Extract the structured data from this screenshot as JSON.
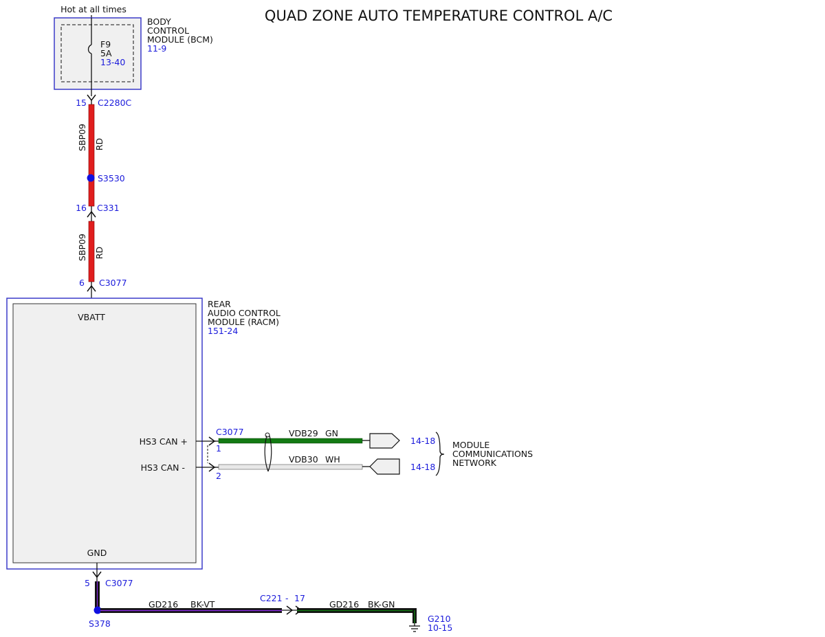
{
  "title": "QUAD ZONE AUTO TEMPERATURE CONTROL A/C",
  "colors": {
    "link": "#1a1adb",
    "wire_red": "#e01e1e",
    "wire_green": "#137a13",
    "wire_white": "#e8e8e8",
    "wire_black": "#111111",
    "wire_violet": "#8a2be2",
    "wire_dark_green": "#0f4d0f",
    "module_fill": "#f0f0f0",
    "module_border": "#3a3ac8"
  },
  "power": {
    "hot_label": "Hot at all times"
  },
  "bcm": {
    "name_lines": [
      "BODY",
      "CONTROL",
      "MODULE (BCM)"
    ],
    "ref": "11-9",
    "fuse": {
      "id": "F9",
      "rating": "5A",
      "ref": "13-40"
    }
  },
  "connectors": {
    "c2280c": {
      "pin": "15",
      "name": "C2280C"
    },
    "s3530": {
      "name": "S3530"
    },
    "c331": {
      "pin": "16",
      "name": "C331"
    },
    "c3077_top": {
      "pin": "6",
      "name": "C3077"
    },
    "c3077_can": {
      "name": "C3077",
      "pin_plus": "1",
      "pin_minus": "2"
    },
    "c3077_gnd": {
      "pin": "5",
      "name": "C3077"
    },
    "s378": {
      "name": "S378"
    },
    "c221": {
      "name": "C221",
      "sep": "-",
      "pin": "17"
    },
    "g210": {
      "name": "G210",
      "ref": "10-15"
    }
  },
  "wires": {
    "sbp09_a": {
      "circuit": "SBP09",
      "color": "RD"
    },
    "sbp09_b": {
      "circuit": "SBP09",
      "color": "RD"
    },
    "vdb29": {
      "circuit": "VDB29",
      "color": "GN",
      "ref": "14-18"
    },
    "vdb30": {
      "circuit": "VDB30",
      "color": "WH",
      "ref": "14-18"
    },
    "gd216_a": {
      "circuit": "GD216",
      "color": "BK-VT"
    },
    "gd216_b": {
      "circuit": "GD216",
      "color": "BK-GN"
    }
  },
  "racm": {
    "name_lines": [
      "REAR",
      "AUDIO CONTROL",
      "MODULE (RACM)"
    ],
    "ref": "151-24",
    "pins": {
      "vbatt": "VBATT",
      "can_plus": "HS3 CAN +",
      "can_minus": "HS3 CAN -",
      "gnd": "GND"
    }
  },
  "network": {
    "label_lines": [
      "MODULE",
      "COMMUNICATIONS",
      "NETWORK"
    ]
  }
}
